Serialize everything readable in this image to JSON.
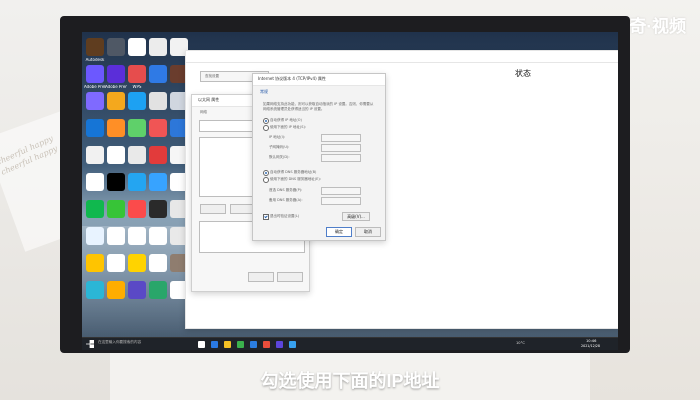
{
  "brand_watermark": "天奇·视频",
  "caption": "勾选使用下面的IP地址",
  "desktop_icons": [
    {
      "label": "Autodesk",
      "color": "#5f3d1f"
    },
    {
      "label": "",
      "color": "#4f5865"
    },
    {
      "label": "",
      "color": "#ffffff"
    },
    {
      "label": "",
      "color": "#ececec"
    },
    {
      "label": "",
      "color": "#f2f2f2"
    },
    {
      "label": "Adobe Prelude",
      "color": "#6c58ff"
    },
    {
      "label": "Adobe Premiere",
      "color": "#5b2ed9"
    },
    {
      "label": "WPS",
      "color": "#e64d4d"
    },
    {
      "label": "",
      "color": "#2f7ae5"
    },
    {
      "label": "",
      "color": "#6a3d2d"
    },
    {
      "label": "",
      "color": "#7f6aff"
    },
    {
      "label": "",
      "color": "#f4a81d"
    },
    {
      "label": "",
      "color": "#1da1f2"
    },
    {
      "label": "",
      "color": "#e2e2e2"
    },
    {
      "label": "",
      "color": "#d0d6df"
    },
    {
      "label": "",
      "color": "#1675d6"
    },
    {
      "label": "",
      "color": "#ff8f26"
    },
    {
      "label": "",
      "color": "#5fd06a"
    },
    {
      "label": "",
      "color": "#f05555"
    },
    {
      "label": "",
      "color": "#2d77d9"
    },
    {
      "label": "",
      "color": "#f1f1f1"
    },
    {
      "label": "",
      "color": "#ffffff"
    },
    {
      "label": "",
      "color": "#e9e9e9"
    },
    {
      "label": "",
      "color": "#e23b3b"
    },
    {
      "label": "",
      "color": "#f6f6f6"
    },
    {
      "label": "",
      "color": "#ffffff"
    },
    {
      "label": "",
      "color": "#000000"
    },
    {
      "label": "",
      "color": "#24a5f1"
    },
    {
      "label": "",
      "color": "#37a3ff"
    },
    {
      "label": "",
      "color": "#ffffff"
    },
    {
      "label": "",
      "color": "#10b84e"
    },
    {
      "label": "",
      "color": "#37c437"
    },
    {
      "label": "",
      "color": "#fb4b4b"
    },
    {
      "label": "",
      "color": "#2a2a2a"
    },
    {
      "label": "",
      "color": "#e7e7e7"
    },
    {
      "label": "",
      "color": "#e8f3ff"
    },
    {
      "label": "",
      "color": "#ffffff"
    },
    {
      "label": "",
      "color": "#ffffff"
    },
    {
      "label": "",
      "color": "#ffffff"
    },
    {
      "label": "",
      "color": "#e9e9e9"
    },
    {
      "label": "",
      "color": "#ffc400"
    },
    {
      "label": "",
      "color": "#ffffff"
    },
    {
      "label": "",
      "color": "#ffd300"
    },
    {
      "label": "",
      "color": "#ffffff"
    },
    {
      "label": "",
      "color": "#8f7d6f"
    },
    {
      "label": "",
      "color": "#2bb6d6"
    },
    {
      "label": "",
      "color": "#ffad00"
    },
    {
      "label": "",
      "color": "#5a49c6"
    },
    {
      "label": "",
      "color": "#29a66a"
    },
    {
      "label": "",
      "color": "#ffffff"
    }
  ],
  "settings_window": {
    "heading": "状态",
    "search_placeholder": "查找设置",
    "link1": "",
    "link2": ""
  },
  "network_window": {
    "title": "以太网 属性",
    "path": "网络和 Internet",
    "tab": "网络"
  },
  "ipv4_dialog": {
    "title": "Internet 协议版本 4 (TCP/IPv4) 属性",
    "tab": "常规",
    "description": "如果网络支持此功能，则可以获取自动指派的 IP 设置。否则，你需要从网络系统管理员处获得适当的 IP 设置。",
    "radio_auto_ip": "自动获得 IP 地址(O)",
    "radio_manual_ip": "使用下面的 IP 地址(S):",
    "field_ip": "IP 地址(I):",
    "field_mask": "子网掩码(U):",
    "field_gateway": "默认网关(D):",
    "radio_auto_dns": "自动获得 DNS 服务器地址(B)",
    "radio_manual_dns": "使用下面的 DNS 服务器地址(E):",
    "field_dns1": "首选 DNS 服务器(P):",
    "field_dns2": "备用 DNS 服务器(A):",
    "validate_checkbox": "退出时验证设置(L)",
    "advanced_button": "高级(V)...",
    "ok_button": "确定",
    "cancel_button": "取消"
  },
  "taskbar": {
    "search_placeholder": "在这里输入你要搜索的内容",
    "time": "10:46",
    "date": "2021/12/28",
    "temp": "10°C"
  }
}
